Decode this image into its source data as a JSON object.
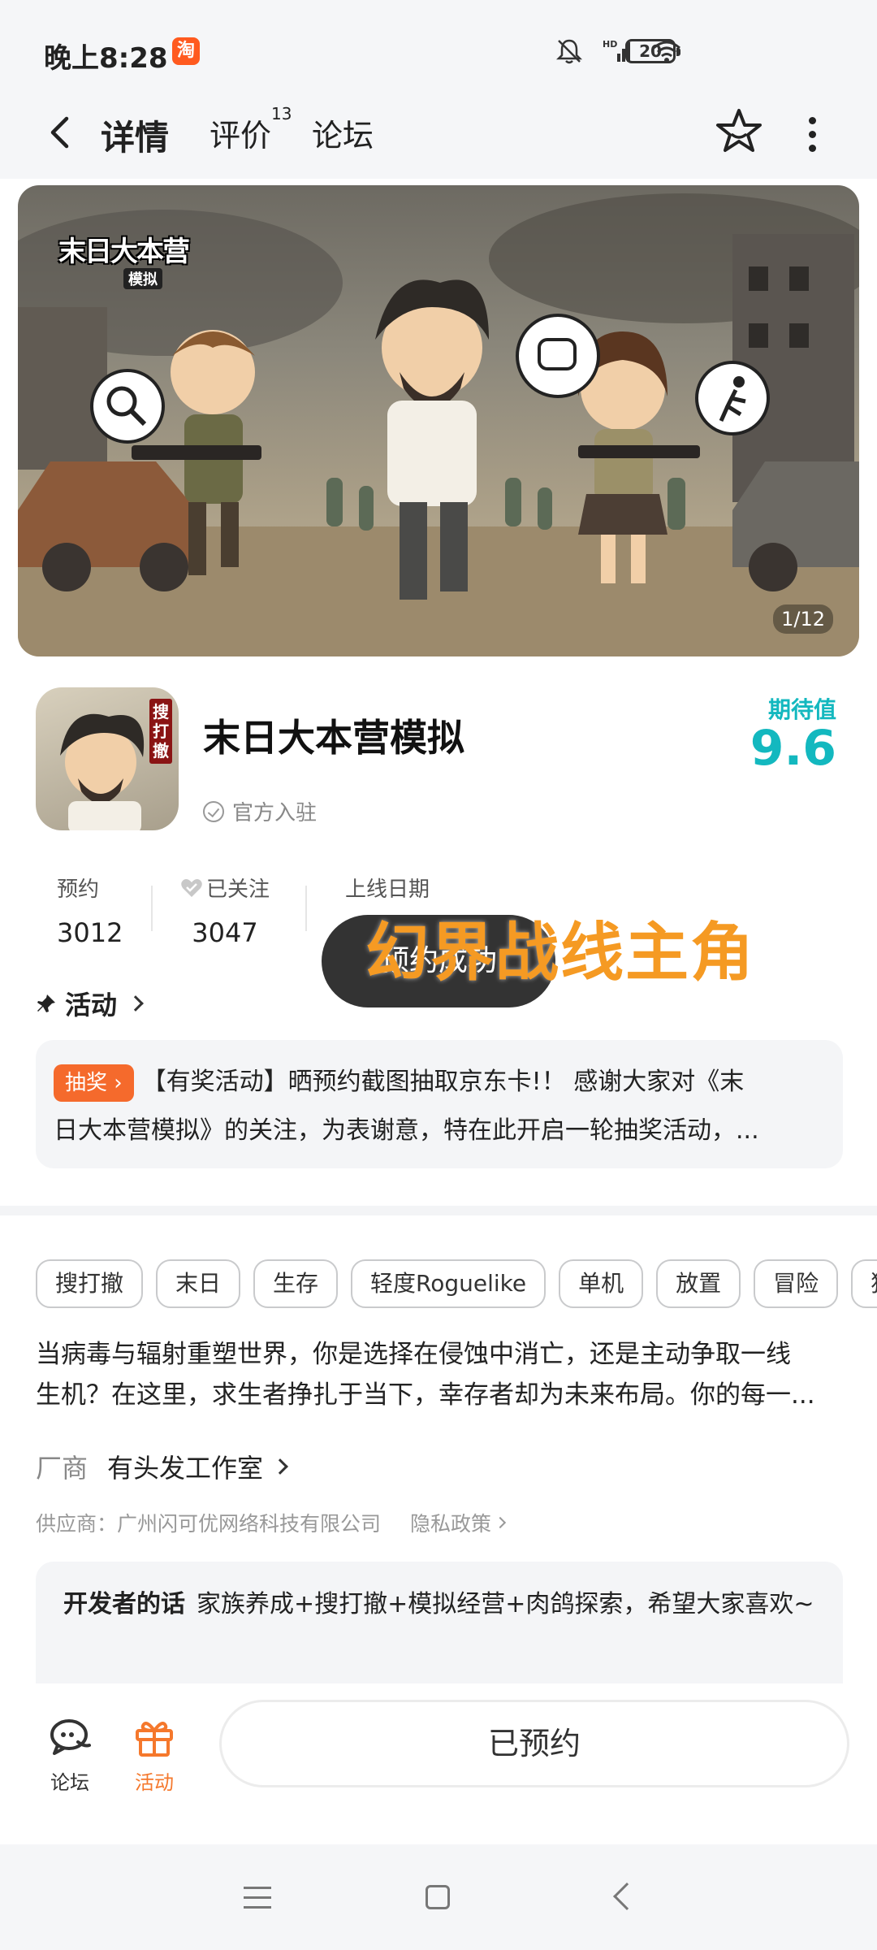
{
  "status_bar": {
    "time": "晚上8:28",
    "app_badge": "淘",
    "battery": "20",
    "network": "HD"
  },
  "nav": {
    "tabs": [
      {
        "label": "详情",
        "active": true
      },
      {
        "label": "评价",
        "count": "13"
      },
      {
        "label": "论坛"
      }
    ]
  },
  "banner": {
    "logo_text": "末日大本营",
    "logo_sub": "模拟",
    "counter": "1/12"
  },
  "app": {
    "icon_tag": "搜打撤",
    "title": "末日大本营模拟",
    "official": "官方入驻",
    "expect_label": "期待值",
    "expect_value": "9.6"
  },
  "stats": {
    "reserve_label": "预约",
    "reserve_value": "3012",
    "follow_label": "已关注",
    "follow_value": "3047",
    "launch_label": "上线日期"
  },
  "toast": "预约成功",
  "overlay_text": "幻界战线主角",
  "activity": {
    "header": "活动",
    "badge": "抽奖",
    "line1": "【有奖活动】晒预约截图抽取京东卡!！ 感谢大家对《末",
    "line2": "日大本营模拟》的关注，为表谢意，特在此开启一轮抽奖活动，..."
  },
  "tags": [
    "搜打撤",
    "末日",
    "生存",
    "轻度Roguelike",
    "单机",
    "放置",
    "冒险",
    "独立"
  ],
  "description": {
    "line1": "当病毒与辐射重塑世界，你是选择在侵蚀中消亡，还是主动争取一线",
    "line2": "生机？在这里，求生者挣扎于当下，幸存者却为未来布局。你的每一..."
  },
  "vendor": {
    "label": "厂商",
    "name": "有头发工作室"
  },
  "supplier": {
    "text": "供应商：广州闪可优网络科技有限公司",
    "privacy": "隐私政策"
  },
  "developer": {
    "label": "开发者的话",
    "text": "家族养成+搜打撤+模拟经营+肉鸽探索，希望大家喜欢~"
  },
  "bottom_bar": {
    "forum": "论坛",
    "activity": "活动",
    "reserved": "已预约"
  },
  "colors": {
    "accent_teal": "#13b8bf",
    "accent_orange": "#f5782c",
    "overlay_orange": "#f59a23"
  }
}
